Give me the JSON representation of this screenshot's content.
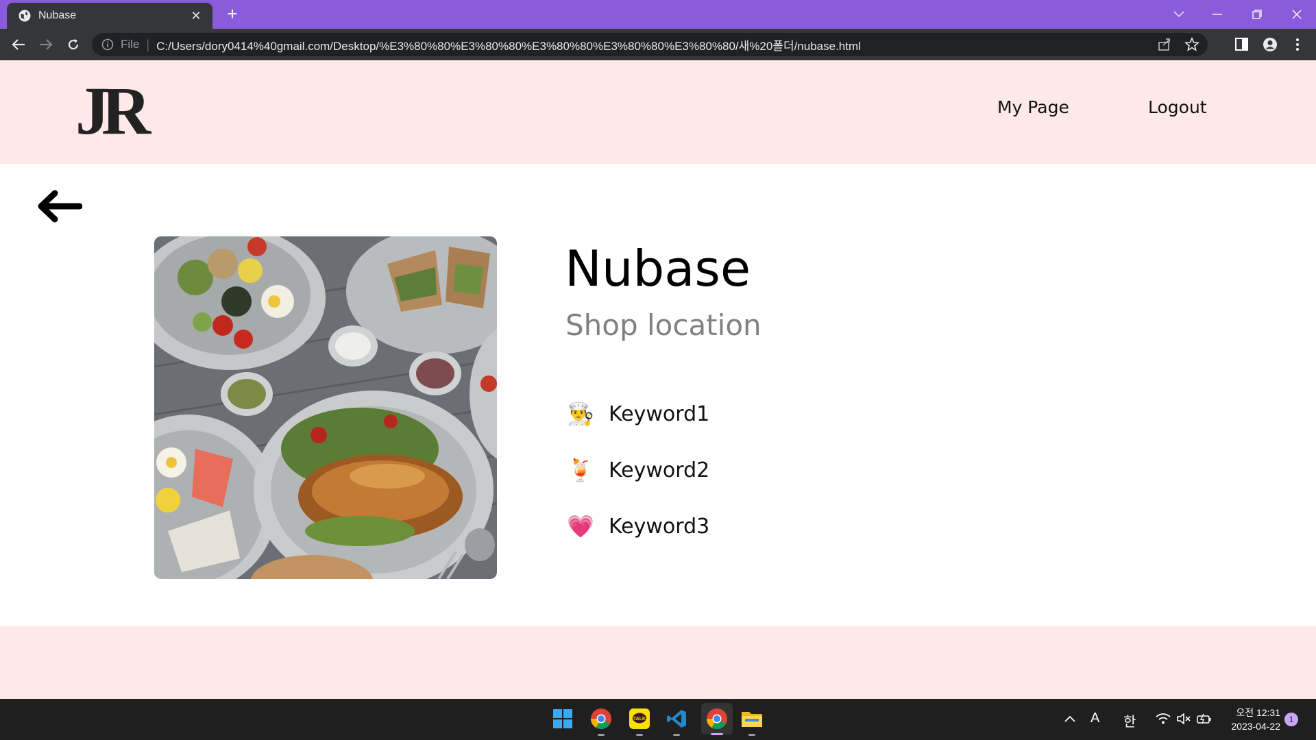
{
  "browser": {
    "tab_title": "Nubase",
    "address_scheme": "File",
    "url": "C:/Users/dory0414%40gmail.com/Desktop/%E3%80%80%E3%80%80%E3%80%80%E3%80%80%E3%80%80/새%20폴더/nubase.html",
    "accent_color": "#8a5cdb"
  },
  "site": {
    "logo": "JR",
    "nav": [
      "My Page",
      "Logout"
    ],
    "header_bg": "#ffe8e8"
  },
  "shop": {
    "name": "Nubase",
    "location": "Shop location",
    "keywords": [
      {
        "icon": "chef-emoji-icon",
        "glyph": "👨‍🍳",
        "label": "Keyword1"
      },
      {
        "icon": "tropical-drink-emoji-icon",
        "glyph": "🍹",
        "label": "Keyword2"
      },
      {
        "icon": "heart-emoji-icon",
        "glyph": "💗",
        "label": "Keyword3"
      }
    ]
  },
  "taskbar": {
    "apps": [
      "windows-start-icon",
      "chrome-icon",
      "kakaotalk-icon",
      "vscode-icon",
      "chrome-active-icon",
      "file-explorer-icon"
    ],
    "tray_font": "A",
    "tray_ime": "한",
    "clock_time": "오전 12:31",
    "clock_date": "2023-04-22",
    "notification_count": "1"
  }
}
